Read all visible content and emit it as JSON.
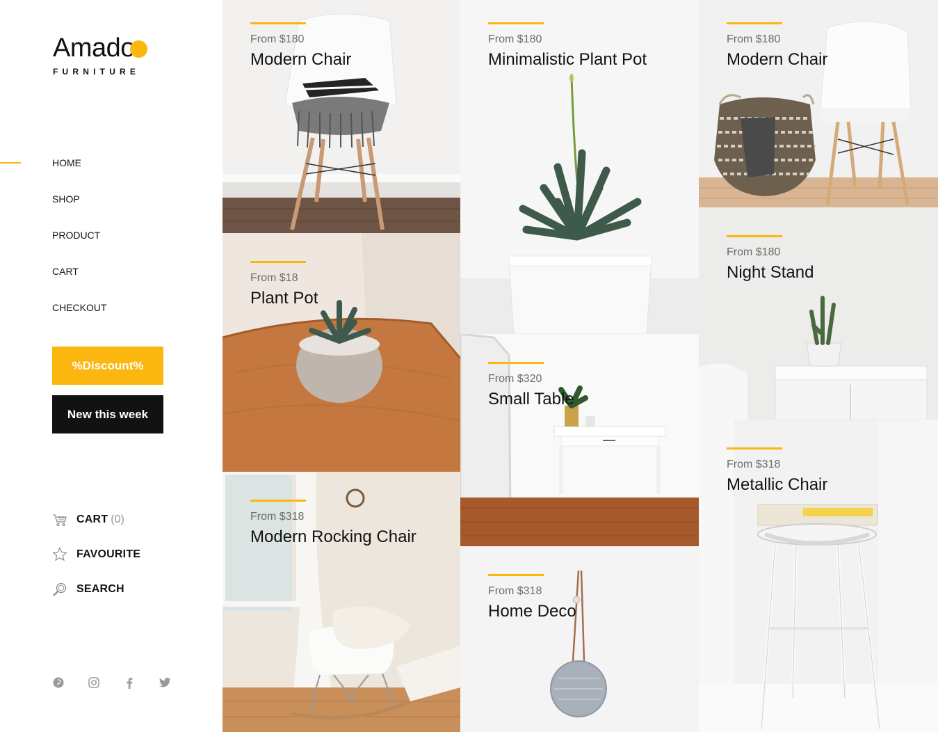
{
  "brand": {
    "name": "Amado",
    "tagline": "FURNITURE",
    "accent": "#fbb710",
    "dark": "#131212"
  },
  "nav": {
    "active": "HOME",
    "items": [
      {
        "label": "HOME"
      },
      {
        "label": "SHOP"
      },
      {
        "label": "PRODUCT"
      },
      {
        "label": "CART"
      },
      {
        "label": "CHECKOUT"
      }
    ]
  },
  "buttons": {
    "discount": "%Discount%",
    "new_this_week": "New this week"
  },
  "quick_links": {
    "cart": {
      "label": "CART",
      "count": "(0)",
      "icon": "cart-icon"
    },
    "favourite": {
      "label": "FAVOURITE",
      "icon": "star-icon"
    },
    "search": {
      "label": "SEARCH",
      "icon": "search-icon"
    }
  },
  "social": [
    "pinterest-icon",
    "instagram-icon",
    "facebook-icon",
    "twitter-icon"
  ],
  "products": [
    {
      "price": "From $180",
      "name": "Modern Chair"
    },
    {
      "price": "From $18",
      "name": "Plant Pot"
    },
    {
      "price": "From $318",
      "name": "Modern Rocking Chair"
    },
    {
      "price": "From $180",
      "name": "Minimalistic Plant Pot"
    },
    {
      "price": "From $320",
      "name": "Small Table"
    },
    {
      "price": "From $318",
      "name": "Home Deco"
    },
    {
      "price": "From $180",
      "name": "Modern Chair"
    },
    {
      "price": "From $180",
      "name": "Night Stand"
    },
    {
      "price": "From $318",
      "name": "Metallic Chair"
    }
  ]
}
